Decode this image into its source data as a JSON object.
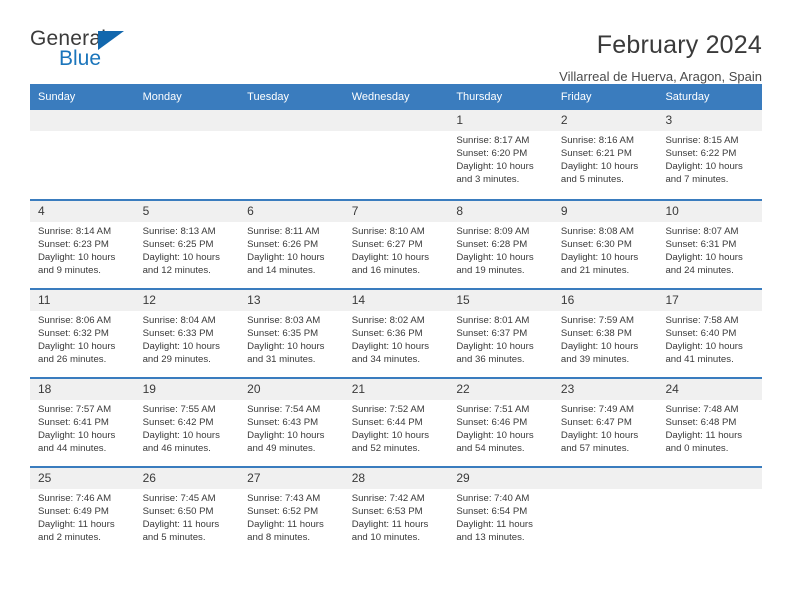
{
  "logo": {
    "word1": "General",
    "word2": "Blue",
    "triangle_color": "#1267ad",
    "blue_color": "#1b75bb"
  },
  "header": {
    "month_title": "February 2024",
    "location": "Villarreal de Huerva, Aragon, Spain"
  },
  "theme": {
    "header_blue": "#3a7cbe",
    "date_band_gray": "#f0f0f0",
    "text_color": "#3a3a3a"
  },
  "calendar": {
    "weekday_headers": [
      "Sunday",
      "Monday",
      "Tuesday",
      "Wednesday",
      "Thursday",
      "Friday",
      "Saturday"
    ],
    "labels": {
      "sunrise": "Sunrise:",
      "sunset": "Sunset:",
      "daylight": "Daylight:"
    },
    "weeks": [
      [
        {
          "day": "",
          "empty": true
        },
        {
          "day": "",
          "empty": true
        },
        {
          "day": "",
          "empty": true
        },
        {
          "day": "",
          "empty": true
        },
        {
          "day": "1",
          "sunrise": "Sunrise: 8:17 AM",
          "sunset": "Sunset: 6:20 PM",
          "daylight_l1": "Daylight: 10 hours",
          "daylight_l2": "and 3 minutes."
        },
        {
          "day": "2",
          "sunrise": "Sunrise: 8:16 AM",
          "sunset": "Sunset: 6:21 PM",
          "daylight_l1": "Daylight: 10 hours",
          "daylight_l2": "and 5 minutes."
        },
        {
          "day": "3",
          "sunrise": "Sunrise: 8:15 AM",
          "sunset": "Sunset: 6:22 PM",
          "daylight_l1": "Daylight: 10 hours",
          "daylight_l2": "and 7 minutes."
        }
      ],
      [
        {
          "day": "4",
          "sunrise": "Sunrise: 8:14 AM",
          "sunset": "Sunset: 6:23 PM",
          "daylight_l1": "Daylight: 10 hours",
          "daylight_l2": "and 9 minutes."
        },
        {
          "day": "5",
          "sunrise": "Sunrise: 8:13 AM",
          "sunset": "Sunset: 6:25 PM",
          "daylight_l1": "Daylight: 10 hours",
          "daylight_l2": "and 12 minutes."
        },
        {
          "day": "6",
          "sunrise": "Sunrise: 8:11 AM",
          "sunset": "Sunset: 6:26 PM",
          "daylight_l1": "Daylight: 10 hours",
          "daylight_l2": "and 14 minutes."
        },
        {
          "day": "7",
          "sunrise": "Sunrise: 8:10 AM",
          "sunset": "Sunset: 6:27 PM",
          "daylight_l1": "Daylight: 10 hours",
          "daylight_l2": "and 16 minutes."
        },
        {
          "day": "8",
          "sunrise": "Sunrise: 8:09 AM",
          "sunset": "Sunset: 6:28 PM",
          "daylight_l1": "Daylight: 10 hours",
          "daylight_l2": "and 19 minutes."
        },
        {
          "day": "9",
          "sunrise": "Sunrise: 8:08 AM",
          "sunset": "Sunset: 6:30 PM",
          "daylight_l1": "Daylight: 10 hours",
          "daylight_l2": "and 21 minutes."
        },
        {
          "day": "10",
          "sunrise": "Sunrise: 8:07 AM",
          "sunset": "Sunset: 6:31 PM",
          "daylight_l1": "Daylight: 10 hours",
          "daylight_l2": "and 24 minutes."
        }
      ],
      [
        {
          "day": "11",
          "sunrise": "Sunrise: 8:06 AM",
          "sunset": "Sunset: 6:32 PM",
          "daylight_l1": "Daylight: 10 hours",
          "daylight_l2": "and 26 minutes."
        },
        {
          "day": "12",
          "sunrise": "Sunrise: 8:04 AM",
          "sunset": "Sunset: 6:33 PM",
          "daylight_l1": "Daylight: 10 hours",
          "daylight_l2": "and 29 minutes."
        },
        {
          "day": "13",
          "sunrise": "Sunrise: 8:03 AM",
          "sunset": "Sunset: 6:35 PM",
          "daylight_l1": "Daylight: 10 hours",
          "daylight_l2": "and 31 minutes."
        },
        {
          "day": "14",
          "sunrise": "Sunrise: 8:02 AM",
          "sunset": "Sunset: 6:36 PM",
          "daylight_l1": "Daylight: 10 hours",
          "daylight_l2": "and 34 minutes."
        },
        {
          "day": "15",
          "sunrise": "Sunrise: 8:01 AM",
          "sunset": "Sunset: 6:37 PM",
          "daylight_l1": "Daylight: 10 hours",
          "daylight_l2": "and 36 minutes."
        },
        {
          "day": "16",
          "sunrise": "Sunrise: 7:59 AM",
          "sunset": "Sunset: 6:38 PM",
          "daylight_l1": "Daylight: 10 hours",
          "daylight_l2": "and 39 minutes."
        },
        {
          "day": "17",
          "sunrise": "Sunrise: 7:58 AM",
          "sunset": "Sunset: 6:40 PM",
          "daylight_l1": "Daylight: 10 hours",
          "daylight_l2": "and 41 minutes."
        }
      ],
      [
        {
          "day": "18",
          "sunrise": "Sunrise: 7:57 AM",
          "sunset": "Sunset: 6:41 PM",
          "daylight_l1": "Daylight: 10 hours",
          "daylight_l2": "and 44 minutes."
        },
        {
          "day": "19",
          "sunrise": "Sunrise: 7:55 AM",
          "sunset": "Sunset: 6:42 PM",
          "daylight_l1": "Daylight: 10 hours",
          "daylight_l2": "and 46 minutes."
        },
        {
          "day": "20",
          "sunrise": "Sunrise: 7:54 AM",
          "sunset": "Sunset: 6:43 PM",
          "daylight_l1": "Daylight: 10 hours",
          "daylight_l2": "and 49 minutes."
        },
        {
          "day": "21",
          "sunrise": "Sunrise: 7:52 AM",
          "sunset": "Sunset: 6:44 PM",
          "daylight_l1": "Daylight: 10 hours",
          "daylight_l2": "and 52 minutes."
        },
        {
          "day": "22",
          "sunrise": "Sunrise: 7:51 AM",
          "sunset": "Sunset: 6:46 PM",
          "daylight_l1": "Daylight: 10 hours",
          "daylight_l2": "and 54 minutes."
        },
        {
          "day": "23",
          "sunrise": "Sunrise: 7:49 AM",
          "sunset": "Sunset: 6:47 PM",
          "daylight_l1": "Daylight: 10 hours",
          "daylight_l2": "and 57 minutes."
        },
        {
          "day": "24",
          "sunrise": "Sunrise: 7:48 AM",
          "sunset": "Sunset: 6:48 PM",
          "daylight_l1": "Daylight: 11 hours",
          "daylight_l2": "and 0 minutes."
        }
      ],
      [
        {
          "day": "25",
          "sunrise": "Sunrise: 7:46 AM",
          "sunset": "Sunset: 6:49 PM",
          "daylight_l1": "Daylight: 11 hours",
          "daylight_l2": "and 2 minutes."
        },
        {
          "day": "26",
          "sunrise": "Sunrise: 7:45 AM",
          "sunset": "Sunset: 6:50 PM",
          "daylight_l1": "Daylight: 11 hours",
          "daylight_l2": "and 5 minutes."
        },
        {
          "day": "27",
          "sunrise": "Sunrise: 7:43 AM",
          "sunset": "Sunset: 6:52 PM",
          "daylight_l1": "Daylight: 11 hours",
          "daylight_l2": "and 8 minutes."
        },
        {
          "day": "28",
          "sunrise": "Sunrise: 7:42 AM",
          "sunset": "Sunset: 6:53 PM",
          "daylight_l1": "Daylight: 11 hours",
          "daylight_l2": "and 10 minutes."
        },
        {
          "day": "29",
          "sunrise": "Sunrise: 7:40 AM",
          "sunset": "Sunset: 6:54 PM",
          "daylight_l1": "Daylight: 11 hours",
          "daylight_l2": "and 13 minutes."
        },
        {
          "day": "",
          "empty": true
        },
        {
          "day": "",
          "empty": true
        }
      ]
    ]
  }
}
